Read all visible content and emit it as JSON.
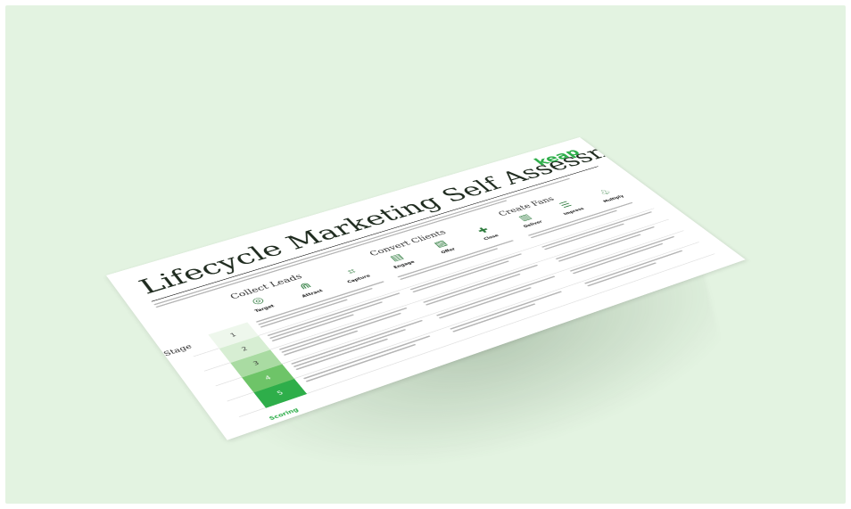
{
  "sheet": {
    "title": "Lifecycle Marketing Self Assessment",
    "logo": "keap",
    "stage_label": "Stage",
    "scoring_label": "Scoring",
    "phases": [
      {
        "name": "Collect Leads"
      },
      {
        "name": "Convert Clients"
      },
      {
        "name": "Create Fans"
      }
    ],
    "steps": [
      {
        "label": "Target",
        "icon": "target-icon"
      },
      {
        "label": "Attract",
        "icon": "magnet-icon"
      },
      {
        "label": "Capture",
        "icon": "net-icon"
      },
      {
        "label": "Engage",
        "icon": "chat-icon"
      },
      {
        "label": "Offer",
        "icon": "tag-icon"
      },
      {
        "label": "Close",
        "icon": "handshake-icon"
      },
      {
        "label": "Deliver",
        "icon": "box-icon"
      },
      {
        "label": "Impress",
        "icon": "star-icon"
      },
      {
        "label": "Multiply",
        "icon": "share-icon"
      }
    ],
    "stages": [
      "1",
      "2",
      "3",
      "4",
      "5"
    ],
    "stage_colors": [
      "#eef7ec",
      "#d7eed3",
      "#a9dba2",
      "#6ec468",
      "#2eae4a"
    ]
  }
}
